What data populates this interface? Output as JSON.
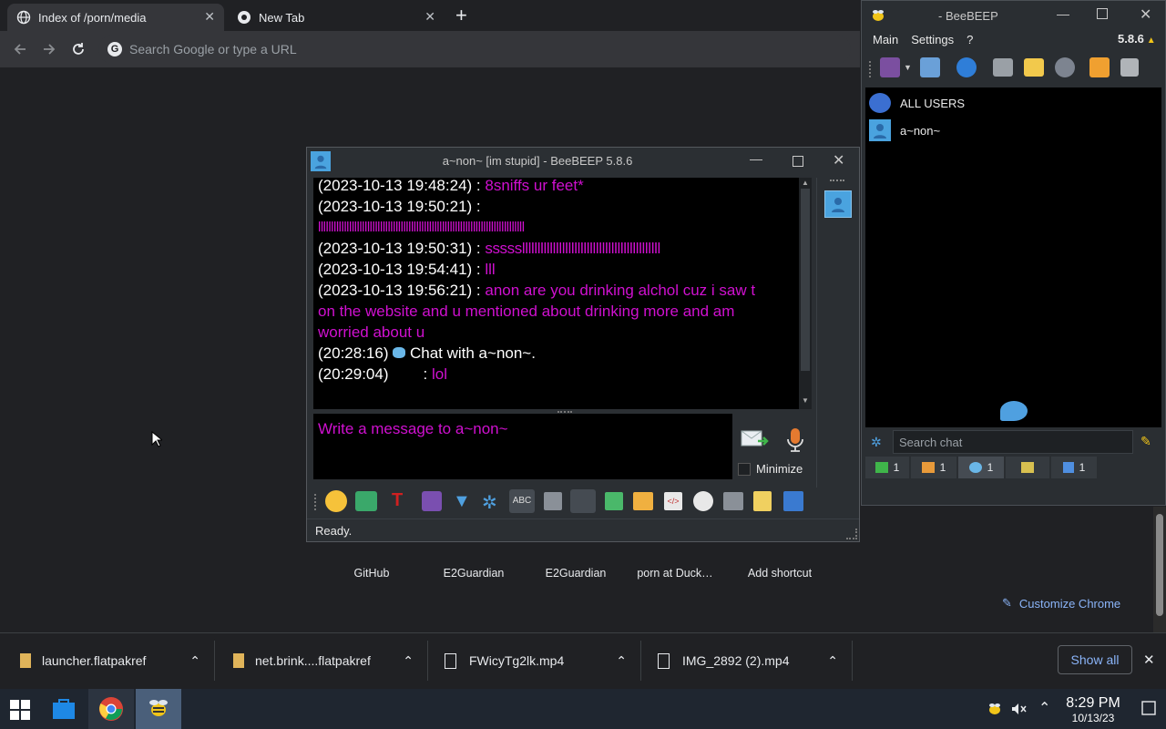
{
  "browser": {
    "tabs": [
      {
        "title": "Index of /porn/media",
        "close": "✕"
      },
      {
        "title": "New Tab",
        "close": "✕"
      }
    ],
    "new_tab_symbol": "+",
    "omnibox_placeholder": "Search Google or type a URL",
    "shortcuts": [
      "GitHub",
      "E2Guardian",
      "E2Guardian",
      "porn at Duck…",
      "Add shortcut"
    ],
    "customize_label": "Customize Chrome"
  },
  "downloads": {
    "items": [
      "launcher.flatpakref",
      "net.brink....flatpakref",
      "FWicyTg2lk.mp4",
      "IMG_2892 (2).mp4"
    ],
    "show_all": "Show all",
    "close": "✕"
  },
  "taskbar": {
    "time": "8:29 PM",
    "date": "10/13/23"
  },
  "beebeep_main": {
    "title": "- BeeBEEP",
    "menu": [
      "Main",
      "Settings",
      "?"
    ],
    "version": "5.8.6",
    "users": [
      "ALL USERS",
      "a~non~"
    ],
    "search_placeholder": "Search chat",
    "counters": [
      "1",
      "1",
      "1",
      "1"
    ]
  },
  "chat_window": {
    "title": "a~non~ [im stupid] - BeeBEEP 5.8.6",
    "messages": [
      {
        "ts": "(2023-10-13 19:48:24) :",
        "text": "8sniffs ur feet*"
      },
      {
        "ts": "(2023-10-13 19:50:21) :",
        "text": ""
      },
      {
        "ts": "",
        "text": "llllllllllllllllllllllllllllllllllllllllllllllllllllllllllllllllllllllllllllllll"
      },
      {
        "ts": "(2023-10-13 19:50:31) :",
        "text": "ssssslllllllllllllllllllllllllllllllllllllllllllll"
      },
      {
        "ts": "(2023-10-13 19:54:41) :",
        "text": "lll"
      },
      {
        "ts": "(2023-10-13 19:56:21) :",
        "text": "anon are you drinking alchol cuz i saw t"
      },
      {
        "ts": "",
        "text": "on the website and u mentioned about drinking more and am"
      },
      {
        "ts": "",
        "text": "worried about u"
      }
    ],
    "system_ts": "(20:28:16)",
    "system_text": "Chat with a~non~.",
    "last_ts": "(20:29:04)",
    "last_sep": ":",
    "last_text": "lol",
    "input_placeholder": "Write a message to a~non~",
    "minimize_label": "Minimize",
    "status": "Ready."
  }
}
